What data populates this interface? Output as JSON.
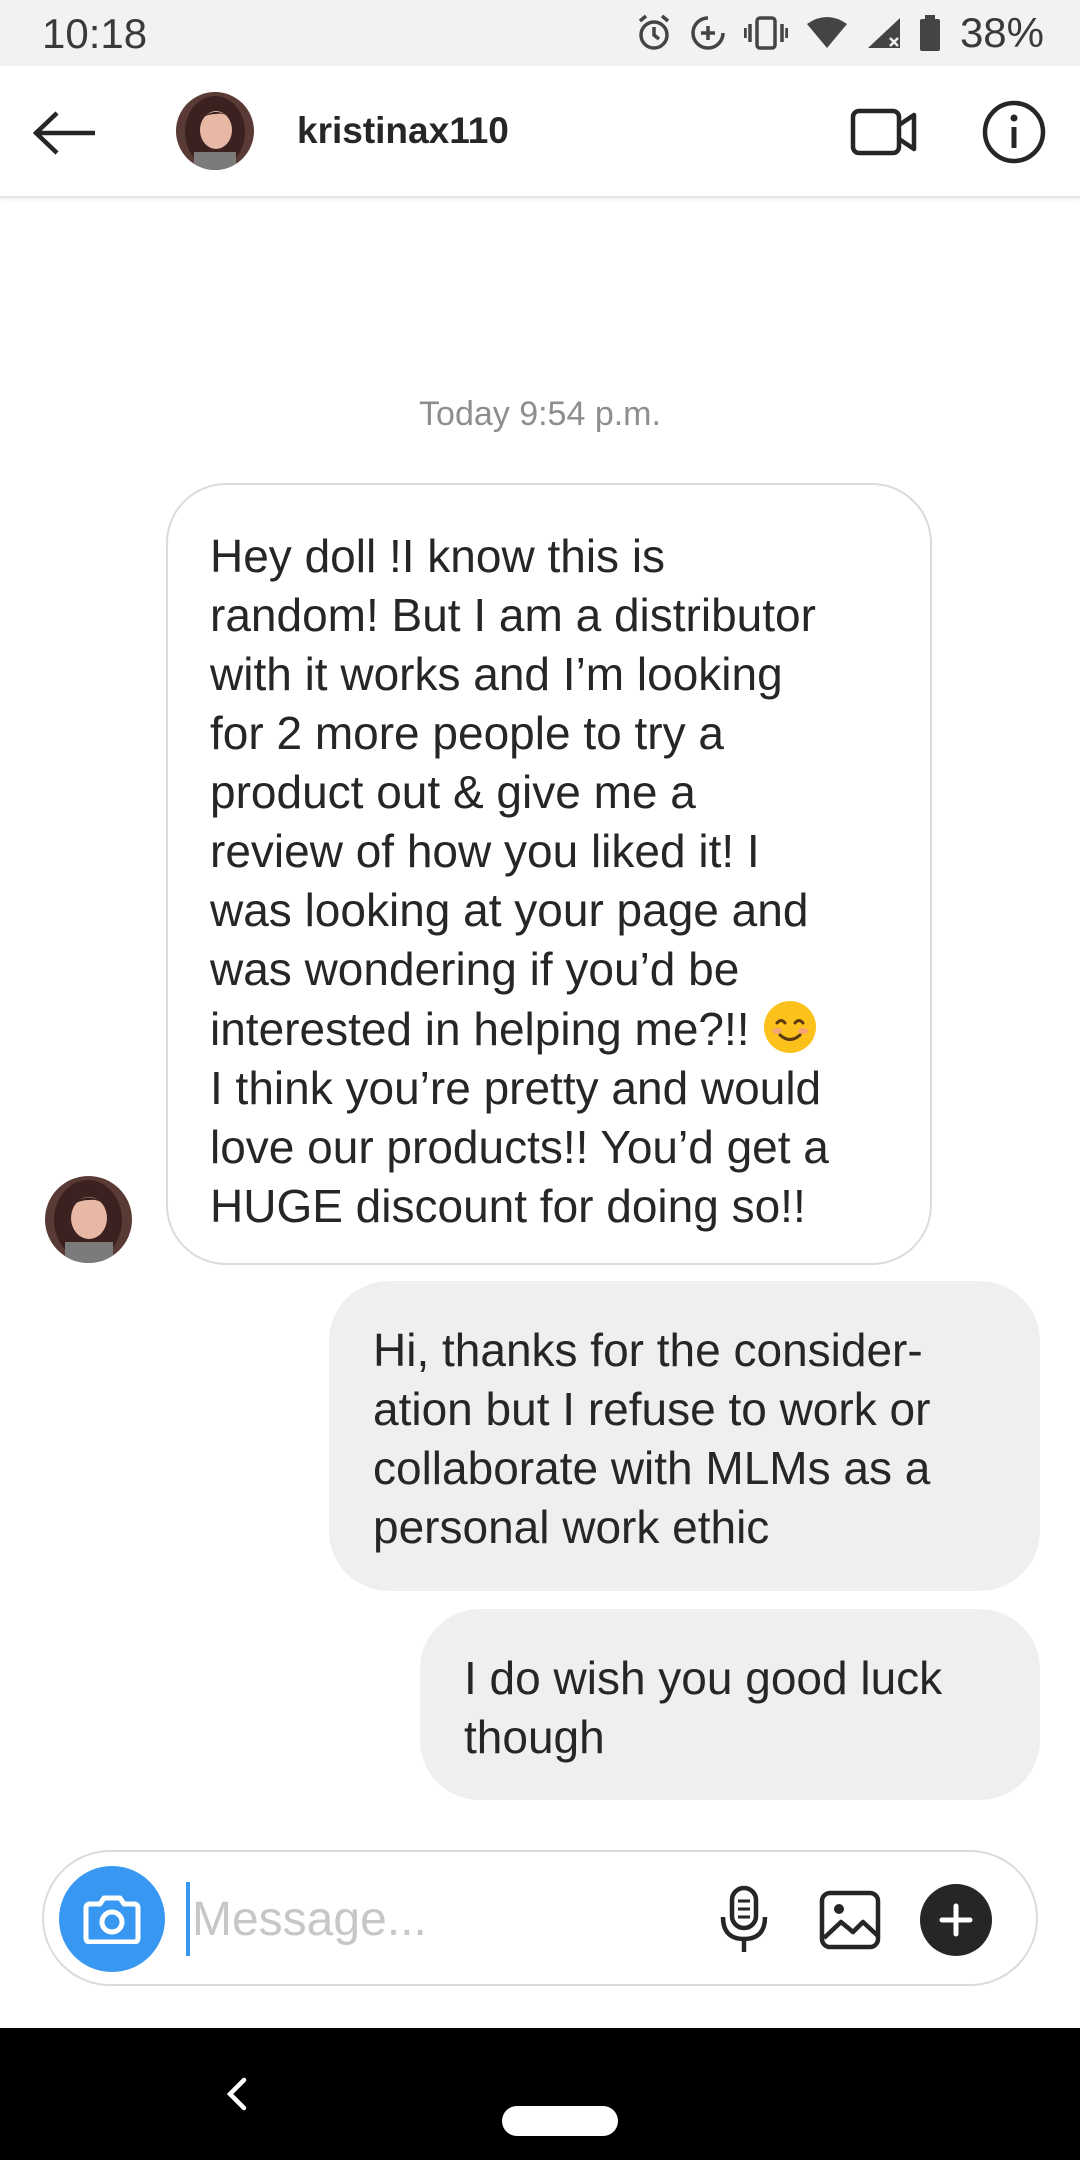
{
  "status_bar": {
    "time": "10:18",
    "battery": "38%",
    "icons": [
      "alarm-icon",
      "data-saver-icon",
      "vibrate-icon",
      "wifi-icon",
      "signal-icon",
      "battery-icon"
    ]
  },
  "header": {
    "back_icon": "arrow-left-icon",
    "username": "kristinax110",
    "video_icon": "video-camera-icon",
    "info_icon": "info-icon"
  },
  "thread": {
    "timestamp": "Today 9:54 p.m.",
    "messages": [
      {
        "direction": "incoming",
        "text_before_emoji": "Hey doll !I know this is\nrandom!  But I am a distributor\nwith it works and I’m looking\nfor 2 more people to try a\nproduct out & give me a\nreview of how you liked it! I\nwas looking at your page and\nwas wondering if you’d be\ninterested in helping me?!! ",
        "emoji": "smiling-face-emoji",
        "text_after_emoji": "\nI think you’re pretty and would\nlove our products!! You’d get a\nHUGE discount for doing so!!"
      },
      {
        "direction": "outgoing",
        "text": "Hi, thanks for the consider-\nation but I refuse to work or\ncollaborate with MLMs as a\npersonal work ethic"
      },
      {
        "direction": "outgoing",
        "text": "I do wish you good luck\nthough"
      }
    ]
  },
  "composer": {
    "placeholder": "Message...",
    "value": "",
    "camera_icon": "camera-icon",
    "mic_icon": "microphone-icon",
    "gallery_icon": "image-icon",
    "plus_icon": "plus-icon"
  },
  "nav_bar": {
    "back_icon": "chevron-left-icon",
    "home_icon": "home-pill-icon"
  },
  "colors": {
    "accent": "#3897f0",
    "outgoing_bubble": "#efefef",
    "incoming_border": "#dbdbdb",
    "timestamp": "#8e8e8e"
  }
}
